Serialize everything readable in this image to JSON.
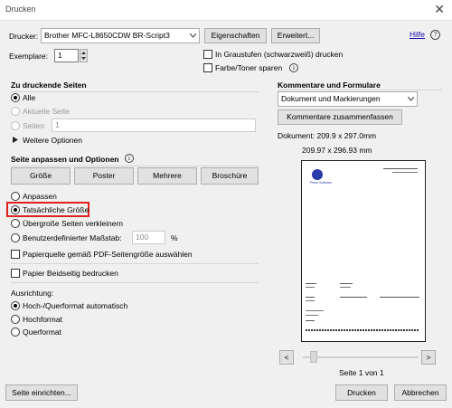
{
  "window": {
    "title": "Drucken",
    "close_glyph": "✕"
  },
  "printer": {
    "label": "Drucker:",
    "value": "Brother MFC-L8650CDW BR-Script3",
    "properties_button": "Eigenschaften",
    "advanced_button": "Erweitert...",
    "help_link": "Hilfe",
    "help_icon": "?"
  },
  "copies": {
    "label": "Exemplare:",
    "value": "1"
  },
  "options": {
    "grayscale": "In Graustufen (schwarzweiß) drucken",
    "save_toner": "Farbe/Toner sparen",
    "info_glyph": "i"
  },
  "pages": {
    "header": "Zu druckende Seiten",
    "all": "Alle",
    "current": "Aktuelle Seite",
    "pages_label": "Seiten",
    "pages_value": "1",
    "more_options": "Weitere Optionen"
  },
  "sizing": {
    "header": "Seite anpassen und Optionen",
    "buttons": [
      "Größe",
      "Poster",
      "Mehrere",
      "Broschüre"
    ],
    "fit": "Anpassen",
    "actual_size": "Tatsächliche Größe",
    "shrink": "Übergroße Seiten verkleinern",
    "custom_scale": "Benutzerdefinierter Maßstab:",
    "scale_value": "100",
    "percent": "%",
    "paper_source": "Papierquelle gemäß PDF-Seitengröße auswählen"
  },
  "duplex": {
    "label": "Papier Beidseitig bedrucken"
  },
  "orientation": {
    "header": "Ausrichtung:",
    "auto": "Hoch-/Querformat automatisch",
    "portrait": "Hochformat",
    "landscape": "Querformat"
  },
  "comments": {
    "header": "Kommentare und Formulare",
    "select_value": "Dokument und Markierungen",
    "summarize_button": "Kommentare zusammenfassen"
  },
  "preview": {
    "document_size": "Dokument: 209.9 x 297.0mm",
    "page_size": "209.97 x 296.93 mm",
    "page_indicator": "Seite 1 von 1",
    "prev": "<",
    "next": ">",
    "logo_text": "Prime Software"
  },
  "footer": {
    "setup_button": "Seite einrichten...",
    "print_button": "Drucken",
    "cancel_button": "Abbrechen"
  },
  "colors": {
    "accent_red": "#e02020",
    "link_blue": "#1a0dab",
    "dialog_bg": "#f0f0f0"
  }
}
